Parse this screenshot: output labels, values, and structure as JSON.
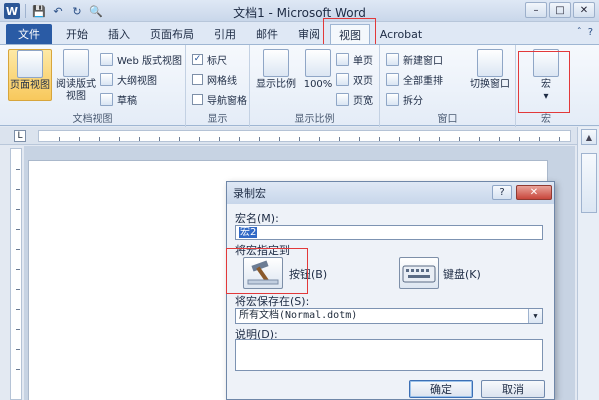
{
  "window": {
    "title": "文档1 - Microsoft Word",
    "min": "–",
    "max": "□",
    "close": "✕"
  },
  "qat": {
    "word_logo": "W",
    "save": "💾",
    "undo": "↶",
    "redo": "↻",
    "print_preview": "🔍"
  },
  "tabs": [
    "文件",
    "开始",
    "插入",
    "页面布局",
    "引用",
    "邮件",
    "审阅",
    "视图",
    "Acrobat"
  ],
  "tab_right": {
    "help": "?",
    "collapse": "ˆ"
  },
  "ribbon": {
    "doc_views": {
      "label": "文档视图",
      "page_view": "页面视图",
      "read_view_line1": "阅读版式",
      "read_view_line2": "视图",
      "web_view": "Web 版式视图",
      "outline": "大纲视图",
      "draft": "草稿"
    },
    "show": {
      "label": "显示",
      "ruler": "标尺",
      "gridlines": "网格线",
      "nav_pane": "导航窗格",
      "ruler_checked": "✓"
    },
    "zoom": {
      "label": "显示比例",
      "zoom_btn": "显示比例",
      "hundred": "100%",
      "one_page": "单页",
      "two_page": "双页",
      "page_width": "页宽"
    },
    "window": {
      "label": "窗口",
      "new_window": "新建窗口",
      "arrange_all": "全部重排",
      "split": "拆分",
      "switch_window": "切换窗口"
    },
    "macro": {
      "label": "宏",
      "macro_btn": "宏",
      "arrow": "▾"
    }
  },
  "ruler": {
    "tab_selector": "L"
  },
  "dialog": {
    "title": "录制宏",
    "help": "?",
    "close": "✕",
    "macro_name_label": "宏名(M):",
    "macro_name_value": "宏2",
    "assign_label": "将宏指定到",
    "button_label": "按钮(B)",
    "keyboard_label": "键盘(K)",
    "store_label": "将宏保存在(S):",
    "store_value": "所有文档(Normal.dotm)",
    "desc_label": "说明(D):",
    "ok": "确定",
    "cancel": "取消"
  },
  "colors": {
    "accent": "#2a5ba5",
    "highlight": "#e2393a",
    "dialog_bg": "#eef2f8"
  }
}
